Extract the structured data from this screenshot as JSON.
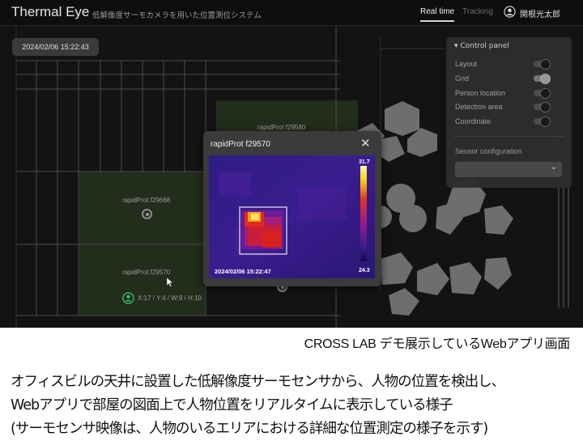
{
  "header": {
    "app_title": "Thermal Eye",
    "app_subtitle": "低解像度サーモカメラを用いた位置測位システム",
    "nav": {
      "realtime": "Real time",
      "tracking": "Tracking"
    },
    "user_icon": "user-circle-icon",
    "user_name": "関根光太郎"
  },
  "map": {
    "timestamp": "2024/02/06 15:22:43",
    "sensors": [
      {
        "label": "rapidProt f29580"
      },
      {
        "label": "rapidProt f29668"
      },
      {
        "label": "rapidProt f29570"
      }
    ],
    "person": {
      "icon": "person-location-icon",
      "coordinate": "X:17 / Y:4 / W:9 / H:10"
    }
  },
  "control_panel": {
    "title": "Control panel",
    "toggles": [
      {
        "label": "Layout",
        "on": true
      },
      {
        "label": "Grid",
        "on": false
      },
      {
        "label": "Person location",
        "on": true
      },
      {
        "label": "Detection area",
        "on": true
      },
      {
        "label": "Coordinate",
        "on": true
      }
    ],
    "sensor_config_label": "Sensor configuration",
    "sensor_select_value": ""
  },
  "sensor_modal": {
    "title": "rapidProt f29570",
    "close_icon": "close-icon",
    "thermal_timestamp": "2024/02/06 15:22:47",
    "scale_max": "31.7",
    "scale_min": "24.3"
  },
  "caption": {
    "tag": "CROSS LAB デモ展示しているWebアプリ画面",
    "lines": [
      "オフィスビルの天井に設置した低解像度サーモセンサから、人物の位置を検出し、",
      "Webアプリで部屋の図面上で人物位置をリアルタイムに表示している様子",
      "(サーモセンサ映像は、人物のいるエリアにおける詳細な位置測定の様子を示す)"
    ]
  }
}
